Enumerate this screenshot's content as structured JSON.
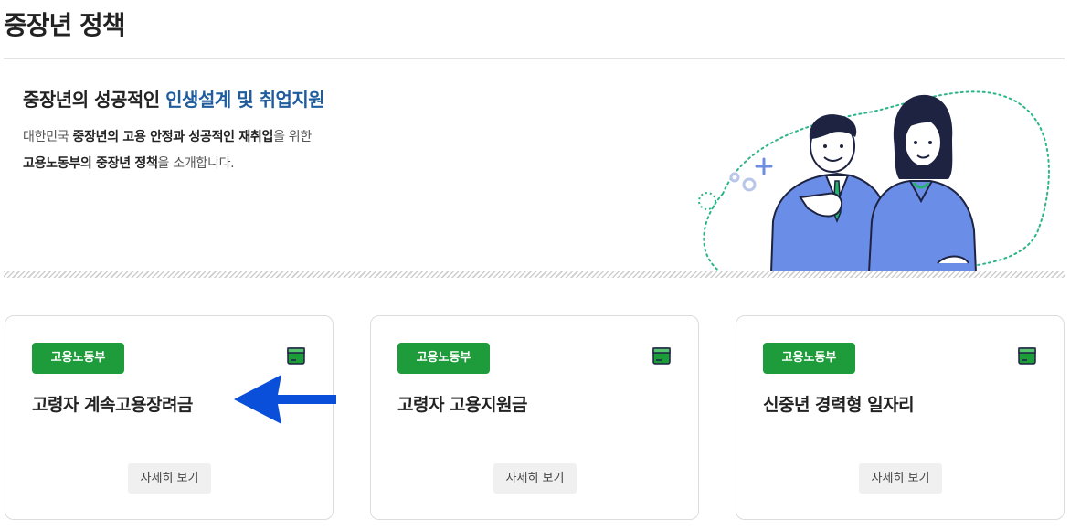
{
  "page": {
    "title": "중장년 정책"
  },
  "hero": {
    "heading_plain": "중장년의 성공적인 ",
    "heading_accent": "인생설계 및 취업지원",
    "desc_line1_part1": "대한민국 ",
    "desc_line1_bold": "중장년의 고용 안정과 성공적인 재취업",
    "desc_line1_part2": "을 위한",
    "desc_line2_bold": "고용노동부의 중장년 정책",
    "desc_line2_part2": "을 소개합니다."
  },
  "cards": [
    {
      "badge": "고용노동부",
      "title": "고령자 계속고용장려금",
      "button": "자세히 보기",
      "icon": "green-folder-icon"
    },
    {
      "badge": "고용노동부",
      "title": "고령자 고용지원금",
      "button": "자세히 보기",
      "icon": "green-folder-icon"
    },
    {
      "badge": "고용노동부",
      "title": "신중년 경력형 일자리",
      "button": "자세히 보기",
      "icon": "green-folder-icon"
    }
  ],
  "colors": {
    "accent_blue": "#1f5c9e",
    "badge_green": "#1e9b3a",
    "arrow_blue": "#0a4fd9"
  }
}
